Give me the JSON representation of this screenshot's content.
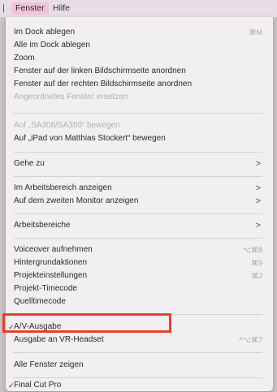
{
  "menubar": {
    "edge": "|",
    "active_title": "Fenster",
    "other_title": "Hilfe"
  },
  "menu": {
    "group1": [
      {
        "label": "Im Dock ablegen",
        "shortcut": "⌘M"
      },
      {
        "label": "Alle im Dock ablegen",
        "shortcut": ""
      },
      {
        "label": "Zoom",
        "shortcut": ""
      },
      {
        "label": "Fenster auf der linken Bildschirmseite anordnen",
        "shortcut": ""
      },
      {
        "label": "Fenster auf der rechten Bildschirmseite anordnen",
        "shortcut": ""
      },
      {
        "label": "Angeordnetes Fenster ersetzen",
        "shortcut": "",
        "disabled": true
      }
    ],
    "group2": [
      {
        "label": "Auf „SA308/SA350“ bewegen",
        "disabled": true
      },
      {
        "label": "Auf „iPad von Matthias Stockert“ bewegen"
      }
    ],
    "goto": {
      "label": "Gehe zu",
      "arrow": ">"
    },
    "group3": [
      {
        "label": "Im Arbeitsbereich anzeigen",
        "arrow": ">"
      },
      {
        "label": "Auf dem zweiten Monitor anzeigen",
        "arrow": ">"
      }
    ],
    "workspaces": {
      "label": "Arbeitsbereiche",
      "arrow": ">"
    },
    "group4": [
      {
        "label": "Voiceover aufnehmen",
        "shortcut": "⌥⌘8"
      },
      {
        "label": "Hintergrundaktionen",
        "shortcut": "⌘9"
      },
      {
        "label": "Projekteinstellungen",
        "shortcut": "⌘J"
      },
      {
        "label": "Projekt-Timecode",
        "shortcut": ""
      },
      {
        "label": "Quelltimecode",
        "shortcut": ""
      }
    ],
    "group5": [
      {
        "label": "A/V-Ausgabe",
        "checked": true,
        "check": "✓",
        "shortcut": ""
      },
      {
        "label": "Ausgabe an VR-Headset",
        "shortcut": "^⌥⌘7"
      }
    ],
    "show_all": {
      "label": "Alle Fenster zeigen"
    },
    "app": {
      "label": "Final Cut Pro",
      "check": "✓"
    }
  },
  "colors": {
    "highlight_border": "#e4432a",
    "active_menu_bg": "#f4c2d7"
  }
}
